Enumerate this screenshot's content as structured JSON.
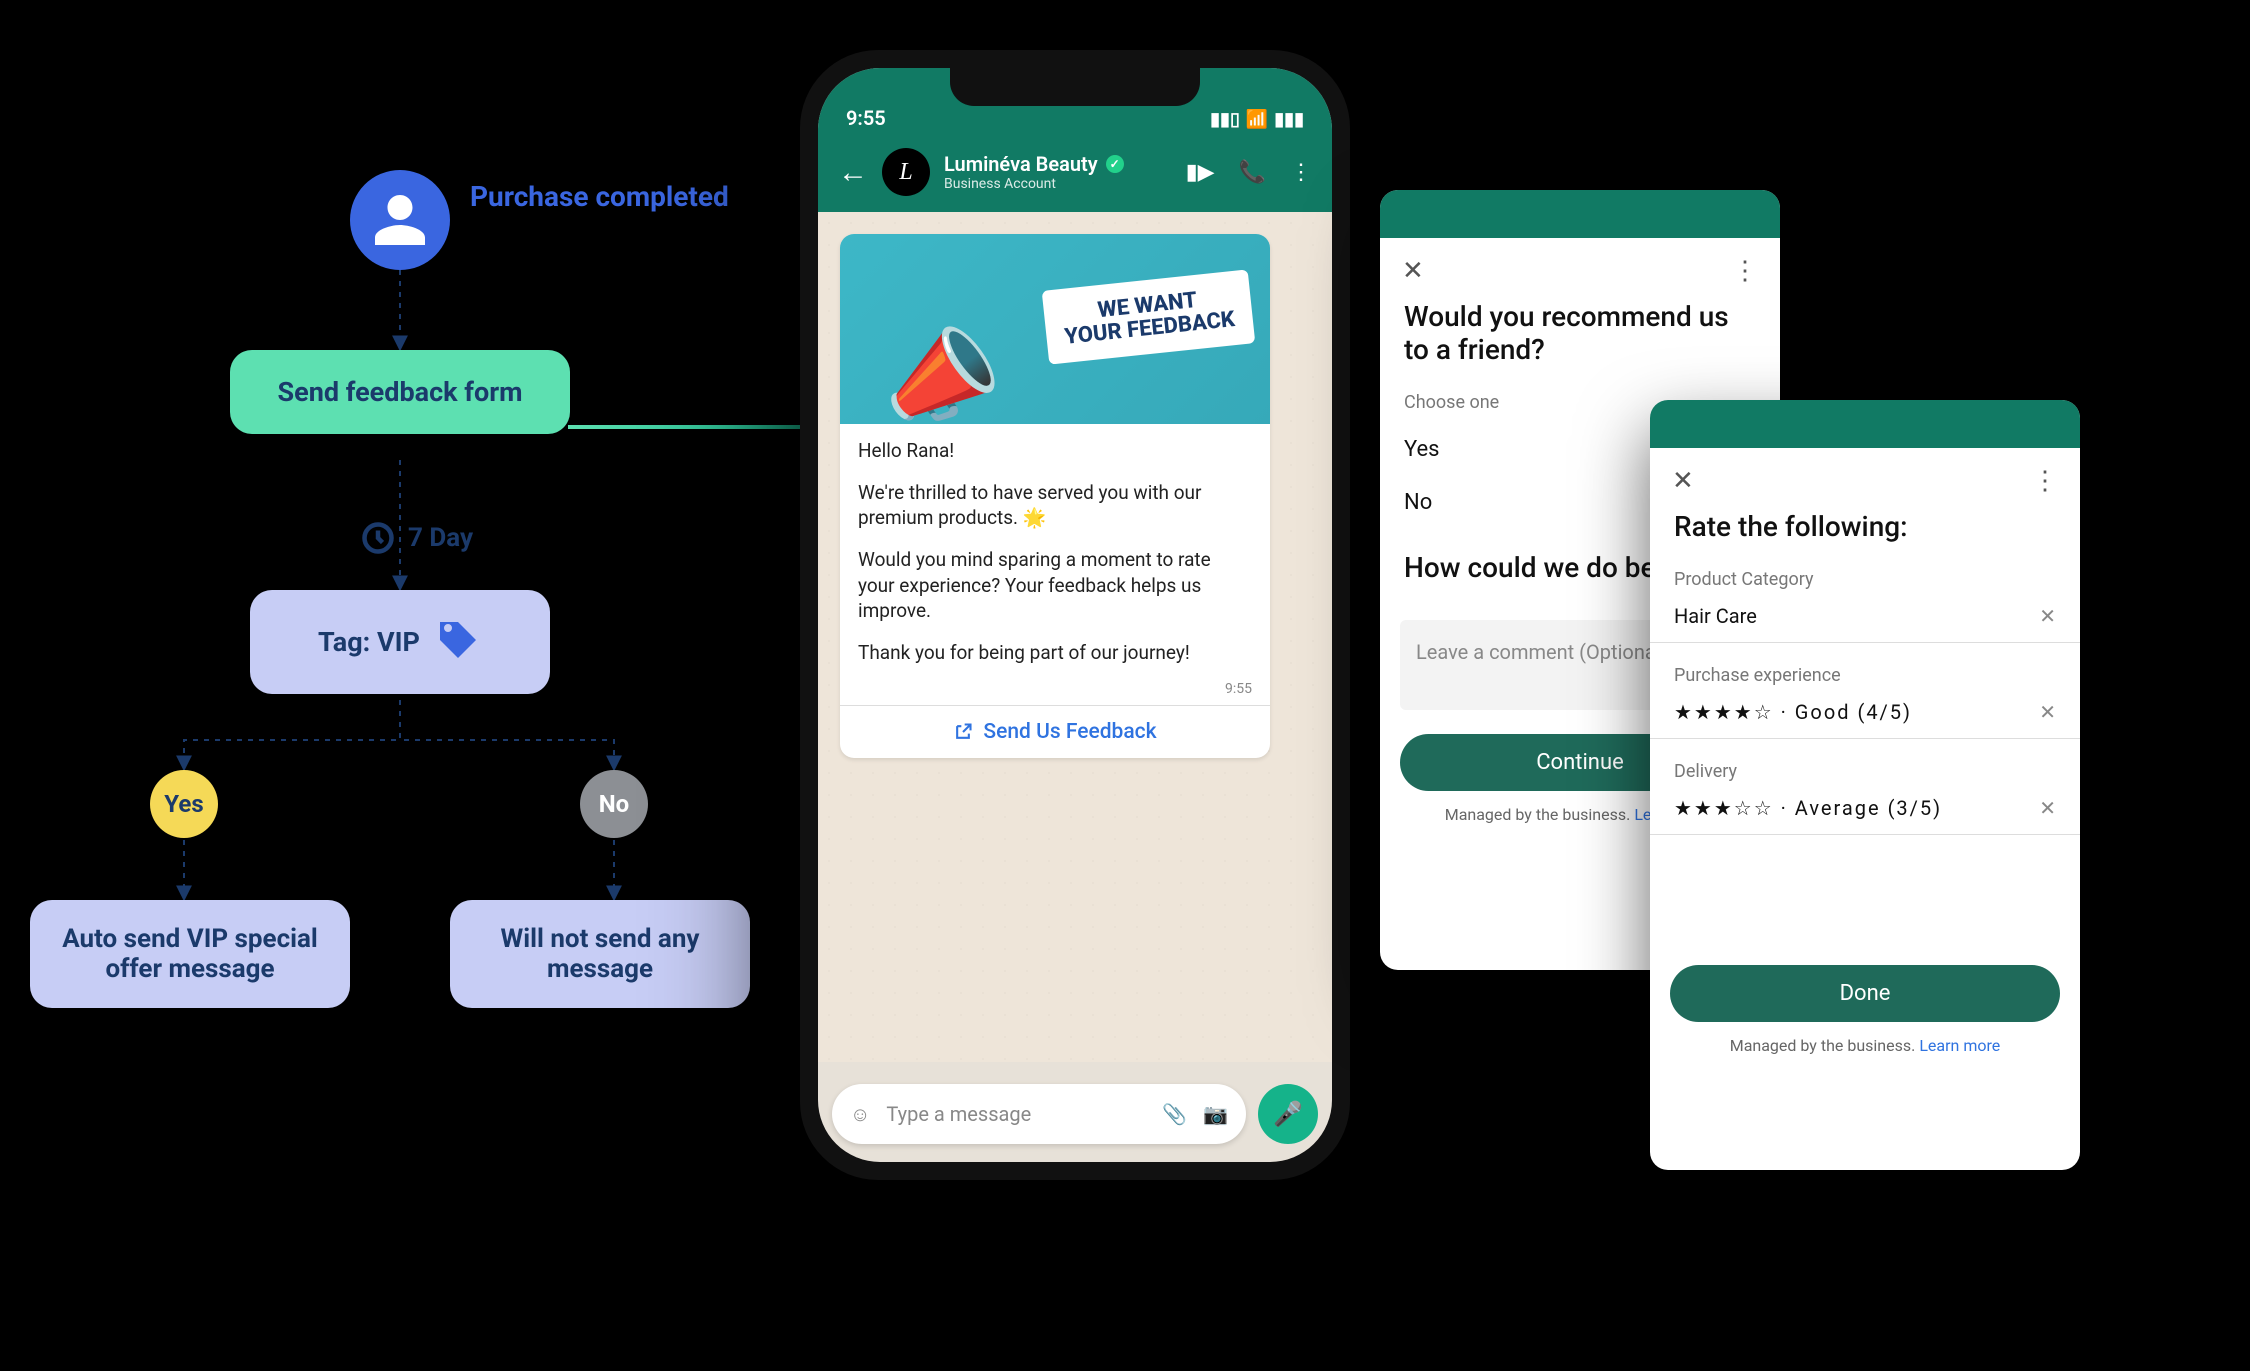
{
  "flow": {
    "trigger_label": "Purchase completed",
    "step_feedback": "Send feedback form",
    "delay_label": "7 Day",
    "tag_label": "Tag: VIP",
    "branch_yes": "Yes",
    "branch_no": "No",
    "leaf_yes": "Auto send VIP special offer message",
    "leaf_no": "Will not send any message"
  },
  "phone": {
    "status_time": "9:55",
    "business_name": "Luminéva Beauty",
    "account_type_label": "Business Account",
    "avatar_letter": "L",
    "image_caption_line1": "WE WANT",
    "image_caption_line2": "YOUR FEEDBACK",
    "msg_greeting": "Hello Rana!",
    "msg_p1": "We're thrilled to have served you with our premium products. 🌟",
    "msg_p2": "Would you mind sparing a moment to rate your experience? Your feedback helps us improve.",
    "msg_p3": "Thank you for being part of our journey!",
    "msg_time": "9:55",
    "cta_label": "Send Us Feedback",
    "input_placeholder": "Type a message"
  },
  "panel1": {
    "title": "Would you recommend us to a friend?",
    "choose_label": "Choose one",
    "opt_yes": "Yes",
    "opt_no": "No",
    "question2": "How could we do better?",
    "comment_placeholder": "Leave a comment (Optional)",
    "btn": "Continue",
    "footer_text": "Managed by the business.",
    "footer_link": "Learn more"
  },
  "panel2": {
    "title": "Rate the following:",
    "cat_label": "Product Category",
    "cat_value": "Hair Care",
    "exp_label": "Purchase experience",
    "exp_value": "★★★★☆ · Good (4/5)",
    "del_label": "Delivery",
    "del_value": "★★★☆☆ · Average (3/5)",
    "btn": "Done",
    "footer_text": "Managed by the business.",
    "footer_link": "Learn more"
  }
}
